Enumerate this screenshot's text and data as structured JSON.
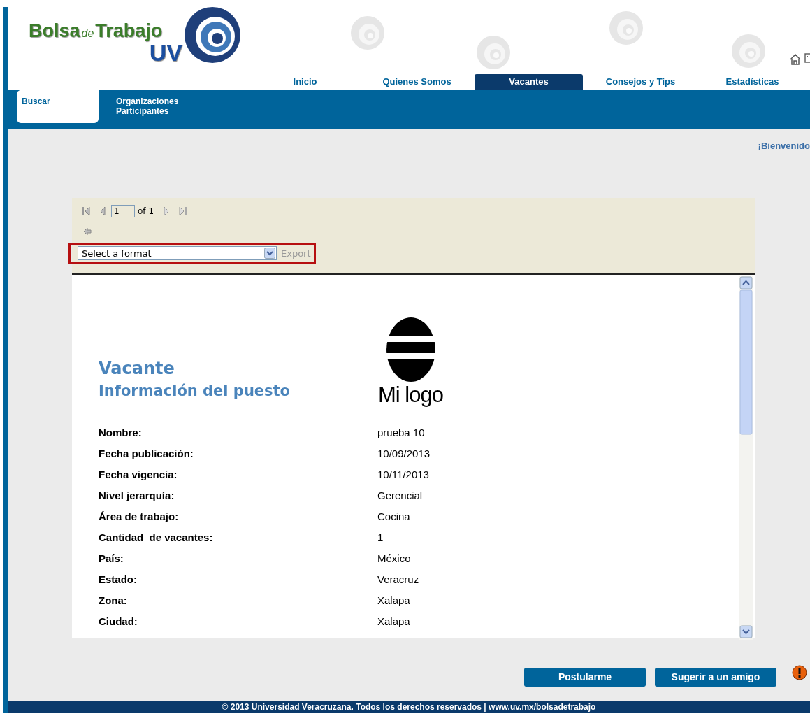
{
  "logo": {
    "word_1": "Bolsa",
    "word_2": "de",
    "word_3": "Trabajo",
    "word_4": "UV"
  },
  "main_nav": [
    {
      "label": "Inicio",
      "selected": false
    },
    {
      "label": "Quienes Somos",
      "selected": false
    },
    {
      "label": "Vacantes",
      "selected": true
    },
    {
      "label": "Consejos y Tips",
      "selected": false
    },
    {
      "label": "Estadísticas",
      "selected": false
    }
  ],
  "sub_nav": [
    {
      "label": "Buscar",
      "selected": true
    },
    {
      "label": "Organizaciones Participantes",
      "selected": false
    }
  ],
  "welcome": "¡Bienvenido",
  "report_toolbar": {
    "page_input": "1",
    "page_total": "of 1",
    "format_select": "Select a format",
    "export": {
      "label": "Export",
      "disabled": true
    }
  },
  "report": {
    "title": "Vacante",
    "subtitle": "Información del puesto",
    "logo_text": "Mi logo",
    "fields": [
      {
        "label": "Nombre:",
        "value": "prueba 10"
      },
      {
        "label": "Fecha publicación:",
        "value": "10/09/2013"
      },
      {
        "label": "Fecha vigencia:",
        "value": "10/11/2013"
      },
      {
        "label": "Nivel jerarquía:",
        "value": "Gerencial"
      },
      {
        "label": "Área de trabajo:",
        "value": "Cocina"
      },
      {
        "label": "Cantidad  de vacantes:",
        "value": "1"
      },
      {
        "label": "País:",
        "value": "México"
      },
      {
        "label": "Estado:",
        "value": "Veracruz"
      },
      {
        "label": "Zona:",
        "value": "Xalapa"
      },
      {
        "label": "Ciudad:",
        "value": "Xalapa"
      }
    ]
  },
  "buttons": [
    "Postularme",
    "Sugerir a un amigo"
  ],
  "footer": "© 2013 Universidad Veracruzana. Todos los derechos reservados | www.uv.mx/bolsadetrabajo"
}
